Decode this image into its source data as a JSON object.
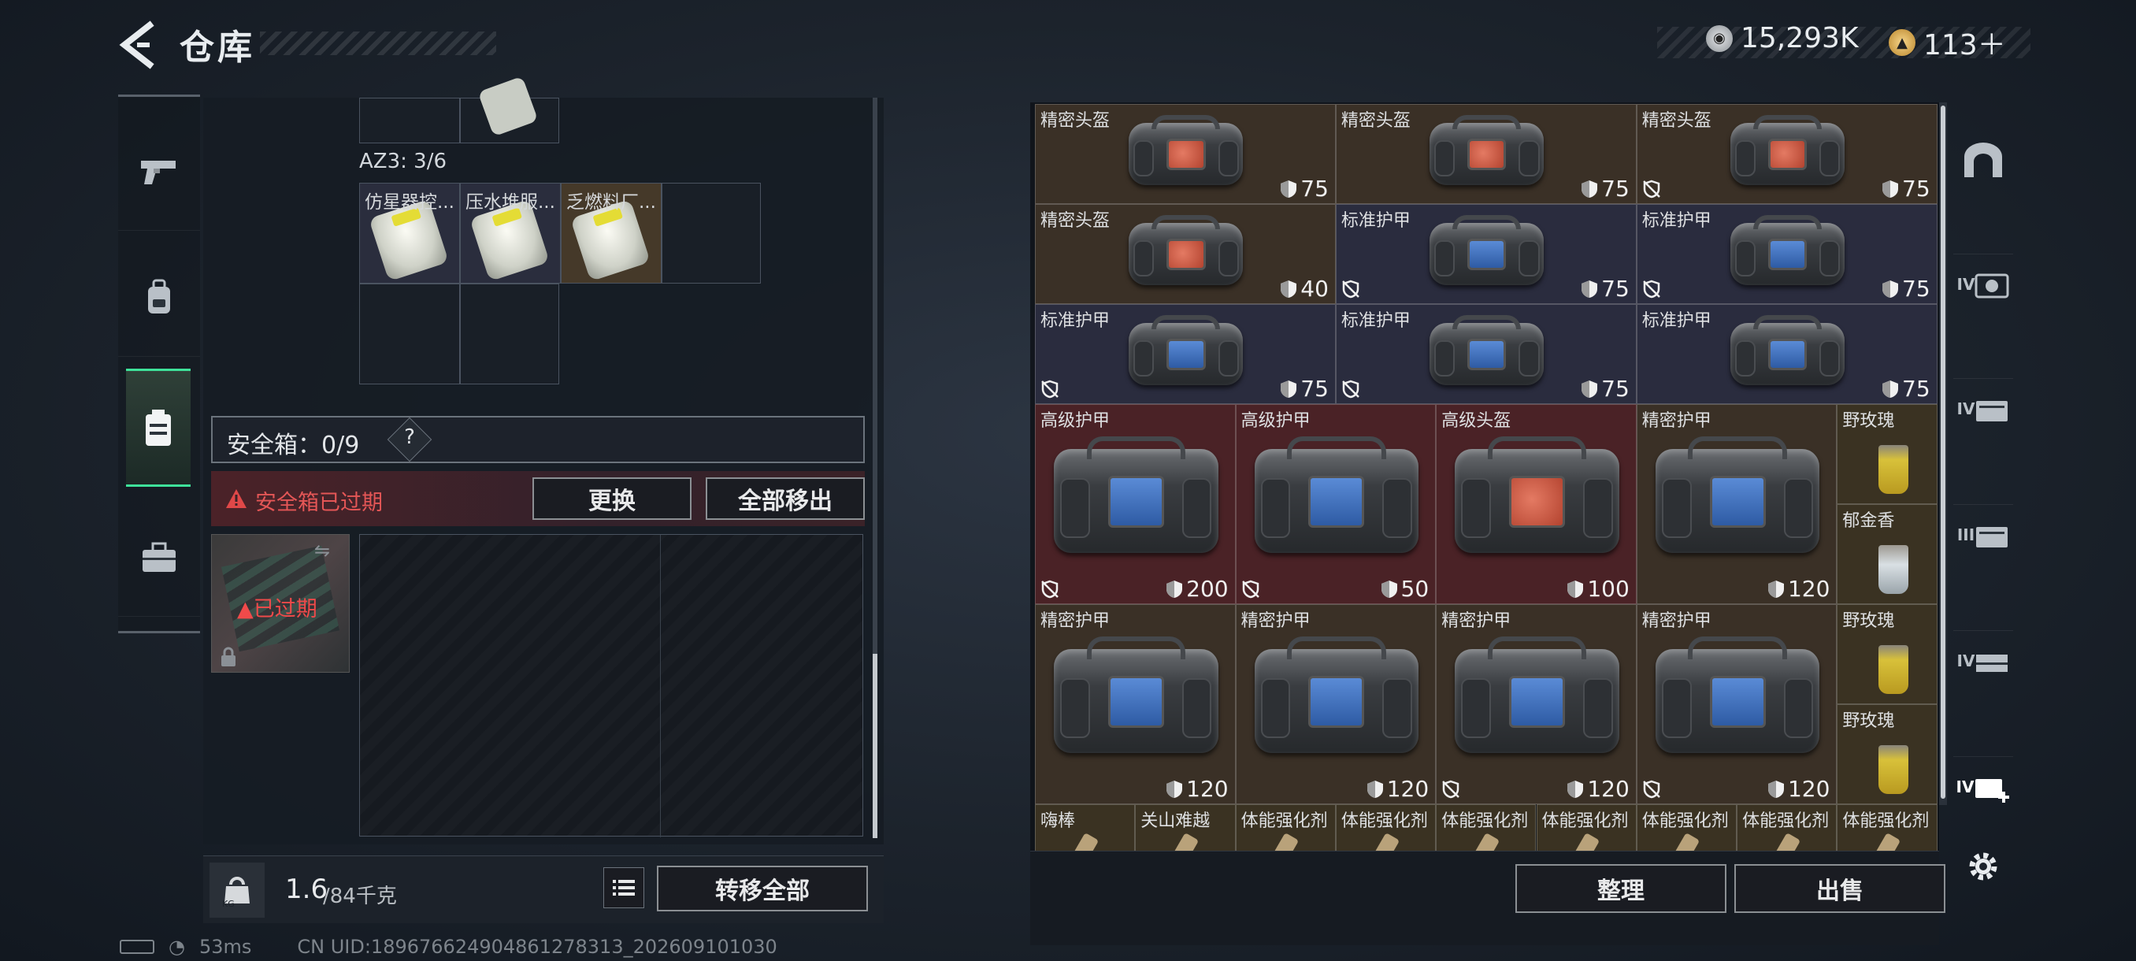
{
  "header": {
    "title": "仓库",
    "currency1": "15,293K",
    "currency2": "113＋"
  },
  "left_panel": {
    "az3_label": "AZ3: 3/6",
    "items": [
      {
        "name": "仿星器控..."
      },
      {
        "name": "压水堆服..."
      },
      {
        "name": "乏燃料厂..."
      }
    ],
    "safebox_label": "安全箱：0/9",
    "safebox_help": "?",
    "expired_warning": "安全箱已过期",
    "replace_button": "更换",
    "move_all_out_button": "全部移出",
    "expired_tag": "已过期",
    "weight_value": "1.6",
    "weight_capacity": "/84千克",
    "weight_icon_text": "KG",
    "transfer_all_button": "转移全部"
  },
  "right_panel": {
    "items": [
      {
        "name": "精密头盔",
        "value": "75",
        "broken": false
      },
      {
        "name": "精密头盔",
        "value": "75",
        "broken": false
      },
      {
        "name": "精密头盔",
        "value": "75",
        "broken": true
      },
      {
        "name": "精密头盔",
        "value": "40",
        "broken": false
      },
      {
        "name": "标准护甲",
        "value": "75",
        "broken": true
      },
      {
        "name": "标准护甲",
        "value": "75",
        "broken": true
      },
      {
        "name": "标准护甲",
        "value": "75",
        "broken": true
      },
      {
        "name": "标准护甲",
        "value": "75",
        "broken": true
      },
      {
        "name": "标准护甲",
        "value": "75",
        "broken": false
      },
      {
        "name": "高级护甲",
        "value": "200",
        "broken": true
      },
      {
        "name": "高级护甲",
        "value": "50",
        "broken": true
      },
      {
        "name": "高级头盔",
        "value": "100",
        "broken": false
      },
      {
        "name": "精密护甲",
        "value": "120",
        "broken": false
      },
      {
        "name": "野玫瑰",
        "value": "",
        "broken": false
      },
      {
        "name": "郁金香",
        "value": "",
        "broken": false
      },
      {
        "name": "精密护甲",
        "value": "120",
        "broken": false
      },
      {
        "name": "精密护甲",
        "value": "120",
        "broken": false
      },
      {
        "name": "精密护甲",
        "value": "120",
        "broken": true
      },
      {
        "name": "精密护甲",
        "value": "120",
        "broken": true
      },
      {
        "name": "野玫瑰",
        "value": "",
        "broken": false
      },
      {
        "name": "野玫瑰",
        "value": "",
        "broken": false
      },
      {
        "name": "嗨棒",
        "value": "",
        "broken": false
      },
      {
        "name": "关山难越",
        "value": "",
        "broken": false
      },
      {
        "name": "体能强化剂",
        "value": "",
        "broken": false
      },
      {
        "name": "体能强化剂",
        "value": "",
        "broken": false
      },
      {
        "name": "体能强化剂",
        "value": "",
        "broken": false
      },
      {
        "name": "体能强化剂",
        "value": "",
        "broken": false
      },
      {
        "name": "体能强化剂",
        "value": "",
        "broken": false
      },
      {
        "name": "体能强化剂",
        "value": "",
        "broken": false
      },
      {
        "name": "体能强化剂",
        "value": "",
        "broken": false
      }
    ],
    "sort_button": "整理",
    "sell_button": "出售"
  },
  "right_rail": {
    "labels": [
      "IV",
      "IV",
      "III",
      "IV",
      "IV"
    ]
  },
  "status": {
    "ping": "53ms",
    "uid": "CN UID:1896766249048612783​13_202609101030"
  },
  "colors": {
    "accent_green": "#3ee29a",
    "warning_red": "#e04848",
    "cell_brown": "#3a3026",
    "cell_navy": "#2a2c3e",
    "cell_red": "#4a2226",
    "cell_gold": "#3a3222"
  }
}
